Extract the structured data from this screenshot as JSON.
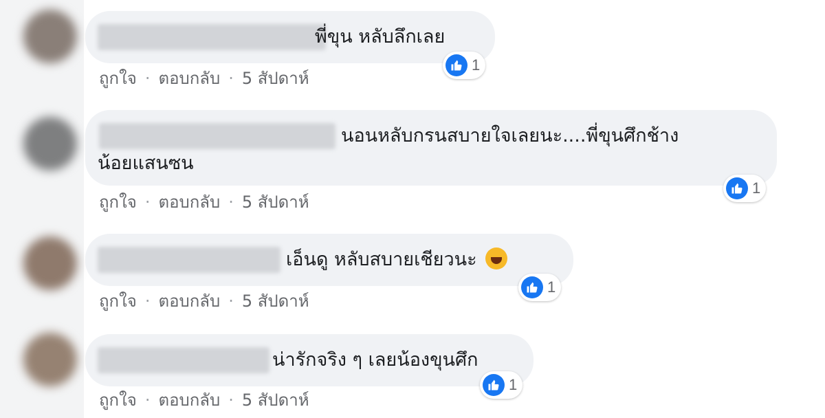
{
  "comments": [
    {
      "text": "พี่ขุน หลับลึกเลย",
      "reactions": "1",
      "actions": {
        "like": "ถูกใจ",
        "reply": "ตอบกลับ",
        "time": "5 สัปดาห์"
      },
      "avatar_color": "#8a7f78"
    },
    {
      "text_line1": "นอนหลับกรนสบายใจเลยนะ....พี่ขุนศึกช้าง",
      "text_line2": "น้อยแสนซน",
      "reactions": "1",
      "actions": {
        "like": "ถูกใจ",
        "reply": "ตอบกลับ",
        "time": "5 สัปดาห์"
      },
      "avatar_color": "#7e7f80"
    },
    {
      "text": "เอ็นดู หลับสบายเชียวนะ",
      "emoji": "rolling-laughing-emoji",
      "reactions": "1",
      "actions": {
        "like": "ถูกใจ",
        "reply": "ตอบกลับ",
        "time": "5 สัปดาห์"
      },
      "avatar_color": "#8f7a6c"
    },
    {
      "text": "น่ารักจริง ๆ เลยน้องขุนศึก",
      "reactions": "1",
      "actions": {
        "like": "ถูกใจ",
        "reply": "ตอบกลับ",
        "time": "5 สัปดาห์"
      },
      "avatar_color": "#968272"
    }
  ],
  "colors": {
    "bubble": "#f0f2f5",
    "like_blue": "#1877f2",
    "meta_text": "#65676b"
  },
  "icons": [
    "like-thumb-icon"
  ]
}
